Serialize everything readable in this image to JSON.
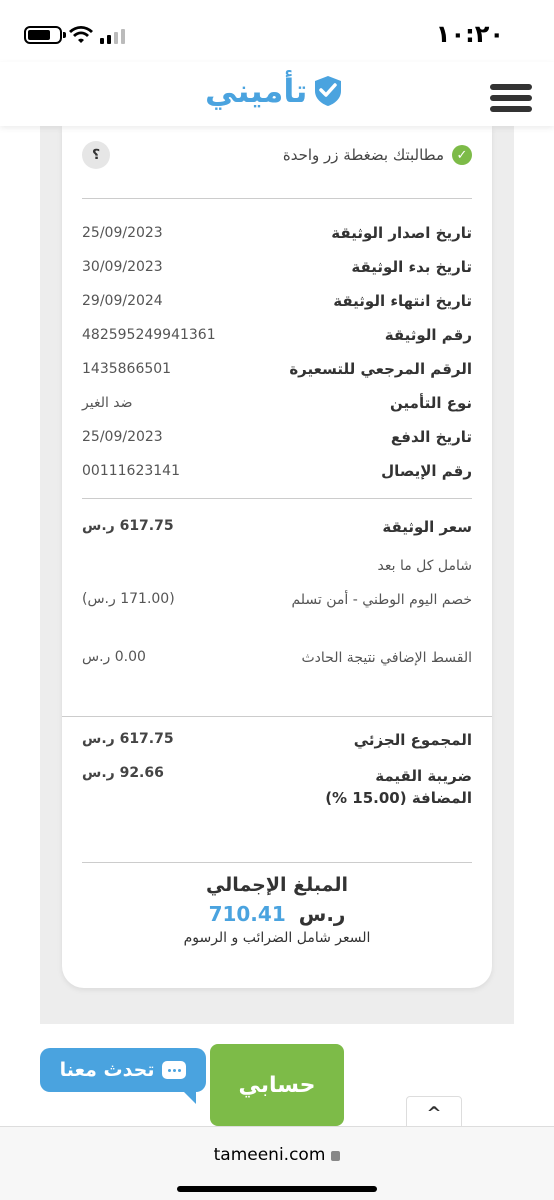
{
  "status_bar": {
    "time": "١٠:٢٠"
  },
  "header": {
    "logo_text": "تأميني"
  },
  "claim": {
    "text": "مطالبتك بضغطة زر واحدة",
    "help": "؟"
  },
  "policy_info": [
    {
      "label": "تاريخ اصدار الوثيقة",
      "value": "25/09/2023"
    },
    {
      "label": "تاريخ بدء الوثيقة",
      "value": "30/09/2023"
    },
    {
      "label": "تاريخ انتهاء الوثيقة",
      "value": "29/09/2024"
    },
    {
      "label": "رقم الوثيقة",
      "value": "482595249941361"
    },
    {
      "label": "الرقم المرجعي للتسعيرة",
      "value": "1435866501"
    },
    {
      "label": "نوع التأمين",
      "value": "ضد الغير"
    },
    {
      "label": "تاريخ الدفع",
      "value": "25/09/2023"
    },
    {
      "label": "رقم الإيصال",
      "value": "00111623141"
    }
  ],
  "pricing": {
    "policy_price_label": "سعر الوثيقة",
    "policy_price_value": "617.75 ر.س",
    "includes_label": "شامل كل ما بعد",
    "discount_label": "خصم اليوم الوطني - أمن تسلم",
    "discount_value": "(171.00 ر.س)",
    "extra_label": "القسط الإضافي نتيجة الحادث",
    "extra_value": "0.00 ر.س"
  },
  "subtotal": {
    "subtotal_label": "المجموع الجزئي",
    "subtotal_value": "617.75 ر.س",
    "vat_label": "ضريبة القيمة المضافة (15.00 %)",
    "vat_value": "92.66 ر.س"
  },
  "total": {
    "title": "المبلغ الإجمالي",
    "amount": "710.41",
    "currency": "ر.س",
    "note": "السعر شامل الضرائب و الرسوم"
  },
  "buttons": {
    "account": "حسابي",
    "chat": "تحدث معنا",
    "scroll_top": "^"
  },
  "browser": {
    "url": "tameeni.com"
  },
  "colors": {
    "brand_blue": "#4aa3df",
    "brand_green": "#7dbb48"
  }
}
